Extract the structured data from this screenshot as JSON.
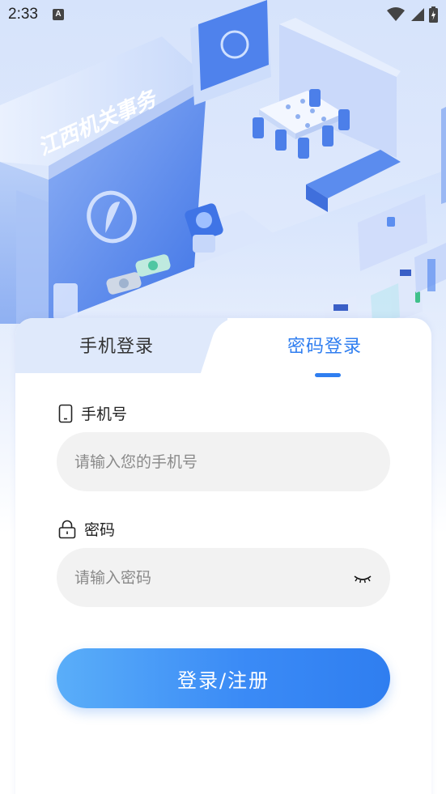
{
  "status_bar": {
    "time": "2:33",
    "notification_icon": "a-icon",
    "icons": [
      "wifi-icon",
      "signal-icon",
      "battery-charging-icon"
    ]
  },
  "hero": {
    "building_sign": "江西机关事务"
  },
  "tabs": [
    {
      "label": "手机登录",
      "active": false
    },
    {
      "label": "密码登录",
      "active": true
    }
  ],
  "form": {
    "phone": {
      "label": "手机号",
      "icon": "phone-icon",
      "placeholder": "请输入您的手机号",
      "value": ""
    },
    "password": {
      "label": "密码",
      "icon": "lock-icon",
      "placeholder": "请输入密码",
      "value": "",
      "toggle_icon": "eye-closed-icon"
    },
    "submit_label": "登录/注册"
  },
  "colors": {
    "accent": "#2f7ef0",
    "button_start": "#5aaef9",
    "button_end": "#2f7ef0",
    "input_bg": "#f2f2f2",
    "hero_bg": "#d6e3fb"
  }
}
